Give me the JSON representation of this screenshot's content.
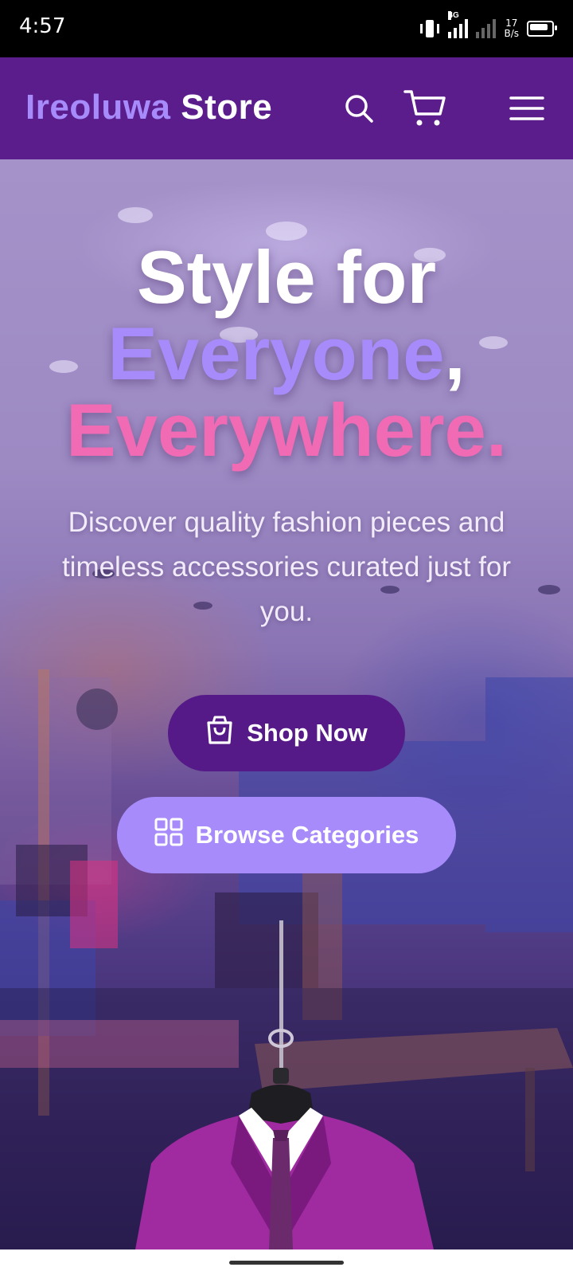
{
  "status_bar": {
    "time": "4:57",
    "network": "4G",
    "speed_value": "17",
    "speed_unit": "B/s"
  },
  "header": {
    "brand_first": "Ireoluwa",
    "brand_second": "Store",
    "icons": [
      "search-icon",
      "cart-icon",
      "menu-icon"
    ]
  },
  "hero": {
    "line1": "Style for",
    "line2": "Everyone",
    "line2_punct": ",",
    "line3": "Everywhere",
    "line3_punct": ".",
    "subtitle": "Discover quality fashion pieces and timeless accessories curated just for you.",
    "shop_button": "Shop Now",
    "browse_button": "Browse Categories"
  },
  "colors": {
    "header_bg": "#5b1d8c",
    "accent_violet": "#a78bfa",
    "accent_pink": "#f06bb4",
    "button_dark": "#561a88"
  }
}
